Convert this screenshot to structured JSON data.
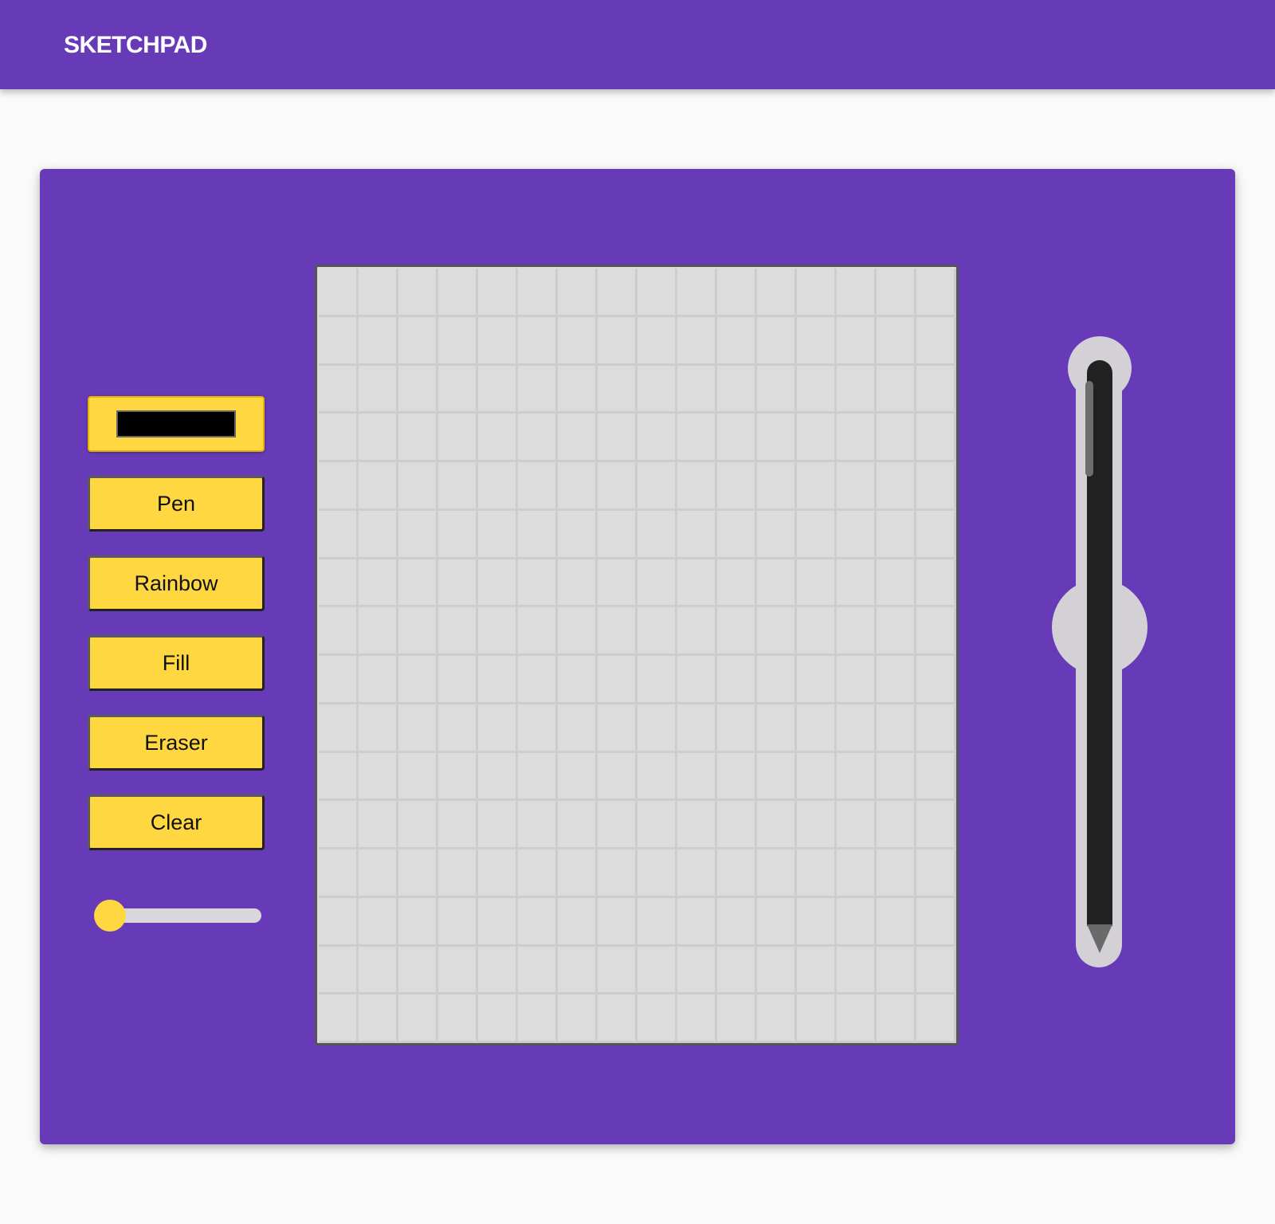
{
  "app": {
    "title": "SKETCHPAD",
    "accent_color": "#673ab7",
    "button_color": "#ffd740"
  },
  "tools": {
    "color_picker": {
      "value": "#000000"
    },
    "buttons": [
      {
        "label": "Pen"
      },
      {
        "label": "Rainbow"
      },
      {
        "label": "Fill"
      },
      {
        "label": "Eraser"
      },
      {
        "label": "Clear"
      }
    ],
    "size_slider": {
      "value_fraction": 0.0
    }
  },
  "canvas": {
    "columns": 16,
    "rows": 16,
    "cell_color": "#dcdcdc"
  },
  "pencil": {
    "icon": "pencil-icon"
  }
}
